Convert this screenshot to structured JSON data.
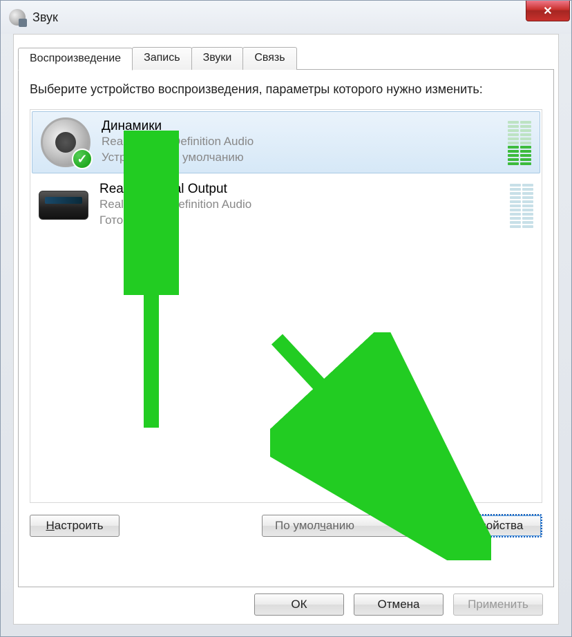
{
  "window": {
    "title": "Звук",
    "closeGlyph": "✕"
  },
  "tabs": [
    {
      "id": "playback",
      "label": "Воспроизведение",
      "active": true
    },
    {
      "id": "recording",
      "label": "Запись",
      "active": false
    },
    {
      "id": "sounds",
      "label": "Звуки",
      "active": false
    },
    {
      "id": "comm",
      "label": "Связь",
      "active": false
    }
  ],
  "instruction": "Выберите устройство воспроизведения, параметры которого нужно изменить:",
  "devices": [
    {
      "id": "speakers",
      "name": "Динамики",
      "driver": "Realtek High Definition Audio",
      "status": "Устройство по умолчанию",
      "selected": true,
      "default": true,
      "icon": "speaker",
      "activeLevel": 5
    },
    {
      "id": "digital",
      "name": "Realtek Digital Output",
      "driver": "Realtek High Definition Audio",
      "status": "Готов",
      "selected": false,
      "default": false,
      "icon": "digital",
      "activeLevel": 0
    }
  ],
  "panelButtons": {
    "configure": {
      "label": "Настроить",
      "accel": "Н"
    },
    "setDefault": {
      "label": "По умолчанию",
      "accel": "ч"
    },
    "properties": {
      "label": "Свойства",
      "accel": "в"
    }
  },
  "dialogButtons": {
    "ok": "ОК",
    "cancel": "Отмена",
    "apply": "Применить"
  }
}
